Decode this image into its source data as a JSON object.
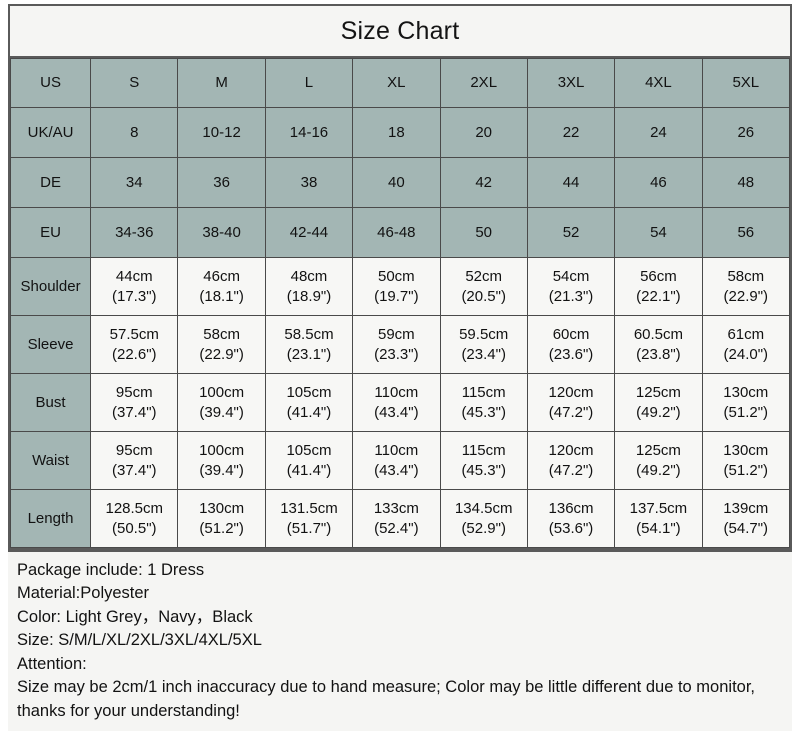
{
  "title": "Size Chart",
  "table": {
    "columns": [
      "US",
      "S",
      "M",
      "L",
      "XL",
      "2XL",
      "3XL",
      "4XL",
      "5XL"
    ],
    "sizing_rows": [
      {
        "label": "UK/AU",
        "values": [
          "8",
          "10-12",
          "14-16",
          "18",
          "20",
          "22",
          "24",
          "26"
        ]
      },
      {
        "label": "DE",
        "values": [
          "34",
          "36",
          "38",
          "40",
          "42",
          "44",
          "46",
          "48"
        ]
      },
      {
        "label": "EU",
        "values": [
          "34-36",
          "38-40",
          "42-44",
          "46-48",
          "50",
          "52",
          "54",
          "56"
        ]
      }
    ],
    "measure_rows": [
      {
        "label": "Shoulder",
        "cm": [
          "44cm",
          "46cm",
          "48cm",
          "50cm",
          "52cm",
          "54cm",
          "56cm",
          "58cm"
        ],
        "inch": [
          "(17.3\")",
          "(18.1\")",
          "(18.9\")",
          "(19.7\")",
          "(20.5\")",
          "(21.3\")",
          "(22.1\")",
          "(22.9\")"
        ]
      },
      {
        "label": "Sleeve",
        "cm": [
          "57.5cm",
          "58cm",
          "58.5cm",
          "59cm",
          "59.5cm",
          "60cm",
          "60.5cm",
          "61cm"
        ],
        "inch": [
          "(22.6\")",
          "(22.9\")",
          "(23.1\")",
          "(23.3\")",
          "(23.4\")",
          "(23.6\")",
          "(23.8\")",
          "(24.0\")"
        ]
      },
      {
        "label": "Bust",
        "cm": [
          "95cm",
          "100cm",
          "105cm",
          "110cm",
          "115cm",
          "120cm",
          "125cm",
          "130cm"
        ],
        "inch": [
          "(37.4\")",
          "(39.4\")",
          "(41.4\")",
          "(43.4\")",
          "(45.3\")",
          "(47.2\")",
          "(49.2\")",
          "(51.2\")"
        ]
      },
      {
        "label": "Waist",
        "cm": [
          "95cm",
          "100cm",
          "105cm",
          "110cm",
          "115cm",
          "120cm",
          "125cm",
          "130cm"
        ],
        "inch": [
          "(37.4\")",
          "(39.4\")",
          "(41.4\")",
          "(43.4\")",
          "(45.3\")",
          "(47.2\")",
          "(49.2\")",
          "(51.2\")"
        ]
      },
      {
        "label": "Length",
        "cm": [
          "128.5cm",
          "130cm",
          "131.5cm",
          "133cm",
          "134.5cm",
          "136cm",
          "137.5cm",
          "139cm"
        ],
        "inch": [
          "(50.5\")",
          "(51.2\")",
          "(51.7\")",
          "(52.4\")",
          "(52.9\")",
          "(53.6\")",
          "(54.1\")",
          "(54.7\")"
        ]
      }
    ]
  },
  "footer": {
    "lines": [
      "Package include: 1 Dress",
      "Material:Polyester",
      "Color: Light Grey，Navy，Black",
      "Size: S/M/L/XL/2XL/3XL/4XL/5XL",
      "Attention:",
      "Size may be 2cm/1 inch inaccuracy due to hand measure; Color may be little different due to monitor, thanks for your understanding!"
    ]
  },
  "colors": {
    "header_teal": "#a3b6b4",
    "data_cell": "#f7f7f5",
    "border": "#4a4a4a",
    "outer_border": "#5a5a5a",
    "text": "#121212"
  }
}
